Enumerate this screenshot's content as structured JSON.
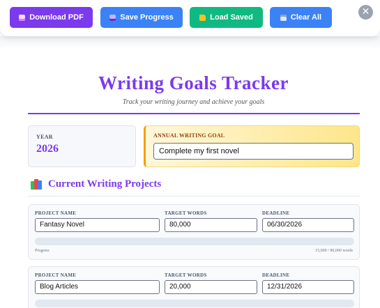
{
  "toolbar": {
    "buttons": [
      {
        "label": "Download PDF",
        "icon": "pdf-icon",
        "color": "#7c3aed"
      },
      {
        "label": "Save Progress",
        "icon": "floppy-disk-icon",
        "color": "#3b82f6"
      },
      {
        "label": "Load Saved",
        "icon": "folder-icon",
        "color": "#10b981"
      },
      {
        "label": "Clear All",
        "icon": "trash-icon",
        "color": "#3b82f6"
      }
    ],
    "close_symbol": "✕"
  },
  "header": {
    "title": "Writing Goals Tracker",
    "subtitle": "Track your writing journey and achieve your goals"
  },
  "year": {
    "label": "YEAR",
    "value": "2026"
  },
  "annual_goal": {
    "label": "ANNUAL WRITING GOAL",
    "value": "Complete my first novel"
  },
  "projects_section": {
    "title": "Current Writing Projects",
    "icon": "books-icon"
  },
  "project_fields": {
    "name_label": "PROJECT NAME",
    "target_label": "TARGET WORDS",
    "deadline_label": "DEADLINE"
  },
  "projects": [
    {
      "name": "Fantasy Novel",
      "target": "80,000",
      "deadline": "06/30/2026",
      "progress_label": "Progress",
      "progress_text": "15,000 / 80,000 words",
      "progress_fraction": 0.0
    },
    {
      "name": "Blog Articles",
      "target": "20,000",
      "deadline": "12/31/2026"
    }
  ],
  "colors": {
    "accent": "#7c3aed",
    "goal_border": "#f59e0b"
  }
}
